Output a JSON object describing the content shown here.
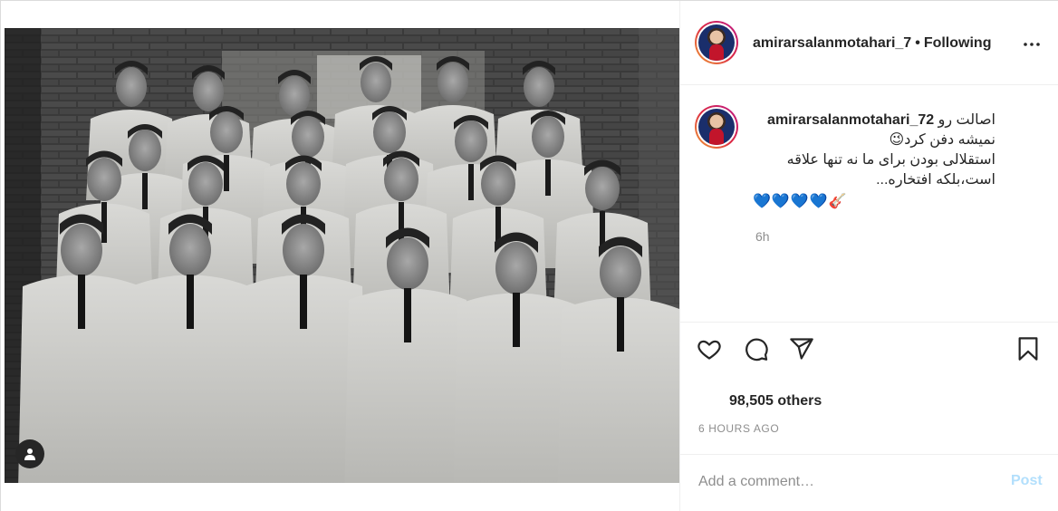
{
  "post": {
    "photo": {
      "description_icon": "tagged-users-icon"
    },
    "header": {
      "username": "amirarsalanmotahari_7",
      "separator": "•",
      "follow_label": "Following",
      "more_icon": "more-options-icon"
    },
    "caption": {
      "username": "amirarsalanmotahari_72",
      "line1": "اصالت رو",
      "line2": "نمیشه دفن کرد😉",
      "line3": "استقلالی بودن برای ما نه تنها علاقه",
      "line4": "است،بلکه افتخاره...",
      "emoji_line": "💙💙💙💙🎸",
      "time": "6h"
    },
    "actions": {
      "like_icon": "heart-icon",
      "comment_icon": "comment-icon",
      "share_icon": "paper-plane-icon",
      "save_icon": "bookmark-icon"
    },
    "likes_text": "98,505 others",
    "time_ago": "6 HOURS AGO",
    "comment": {
      "placeholder": "Add a comment…",
      "post_label": "Post"
    },
    "colors": {
      "link_disabled": "#b2dffc",
      "secondary_text": "#8e8e8e",
      "primary_text": "#262626",
      "border": "#dbdbdb"
    }
  }
}
